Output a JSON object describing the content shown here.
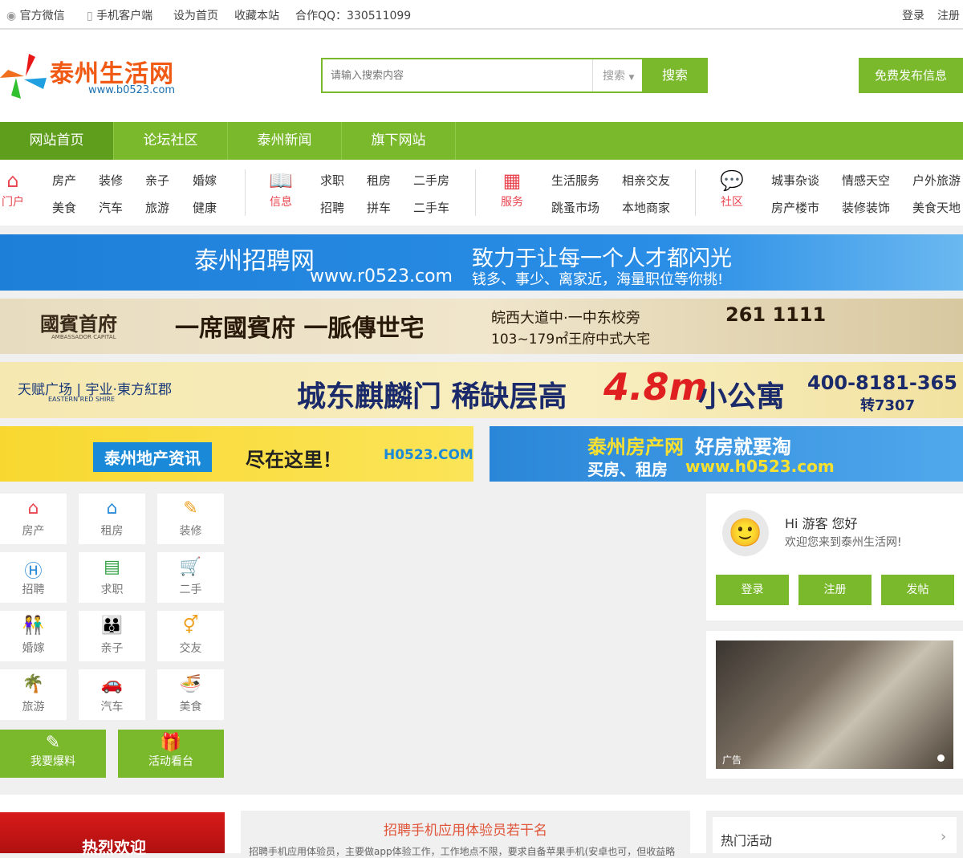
{
  "topbar": {
    "wechat": "官方微信",
    "mobile": "手机客户端",
    "homepage": "设为首页",
    "bookmark": "收藏本站",
    "qq_label": "合作QQ：",
    "qq": "330511099",
    "login": "登录",
    "register": "注册"
  },
  "header": {
    "logo_title": "泰州生活网",
    "logo_url": "www.b0523.com",
    "search_placeholder": "请输入搜索内容",
    "search_select": "搜索",
    "search_button": "搜索",
    "publish": "免费发布信息"
  },
  "nav": [
    "网站首页",
    "论坛社区",
    "泰州新闻",
    "旗下网站"
  ],
  "categories": [
    {
      "title": "门户",
      "items": [
        "房产",
        "装修",
        "亲子",
        "婚嫁",
        "美食",
        "汽车",
        "旅游",
        "健康"
      ]
    },
    {
      "title": "信息",
      "items": [
        "求职",
        "租房",
        "二手房",
        "招聘",
        "拼车",
        "二手车"
      ]
    },
    {
      "title": "服务",
      "items": [
        "生活服务",
        "相亲交友",
        "跳蚤市场",
        "本地商家"
      ]
    },
    {
      "title": "社区",
      "items": [
        "城事杂谈",
        "情感天空",
        "户外旅游",
        "房产楼市",
        "装修装饰",
        "美食天地"
      ]
    }
  ],
  "banners": {
    "b1": {
      "title": "泰州招聘网",
      "url": "www.r0523.com",
      "slogan": "致力于让每一个人才都闪光",
      "sub": "钱多、事少、离家近，海量职位等你挑!"
    },
    "b2": {
      "brand": "國賓首府",
      "brand_en": "AMBASSADOR CAPITAL",
      "slogan": "一席國賓府 一脈傳世宅",
      "loc": "皖西大道中·一中东校旁",
      "area": "103~179㎡王府中式大宅",
      "phone": "261 1111"
    },
    "b3": {
      "brand": "天赋广场 | 宇业·東方紅郡",
      "brand_en": "EASTERN RED SHIRE",
      "slogan": "城东麒麟门  稀缺层高",
      "height": "4.8m",
      "tail": "小公寓",
      "phone": "400-8181-365",
      "ext": "转7307"
    },
    "b4": {
      "text1": "泰州地产资讯",
      "text2": "尽在这里！",
      "url": "H0523.COM"
    },
    "b5": {
      "text1": "泰州房产网",
      "text2": "好房就要淘",
      "text3": "买房、租房",
      "url": "www.h0523.com"
    }
  },
  "tiles": [
    "房产",
    "租房",
    "装修",
    "招聘",
    "求职",
    "二手",
    "婚嫁",
    "亲子",
    "交友",
    "旅游",
    "汽车",
    "美食"
  ],
  "actions": [
    "我要爆料",
    "活动看台"
  ],
  "user": {
    "greeting": "Hi 游客 您好",
    "welcome": "欢迎您来到泰州生活网!",
    "login": "登录",
    "register": "注册",
    "post": "发帖"
  },
  "ad": {
    "label": "广告"
  },
  "bottom": {
    "welcome": "热烈欢迎",
    "job_title": "招聘手机应用体验员若干名",
    "job_desc": "招聘手机应用体验员，主要做app体验工作，工作地点不限，要求自备苹果手机(安卓也可，但收益略",
    "hot": "热门活动"
  }
}
